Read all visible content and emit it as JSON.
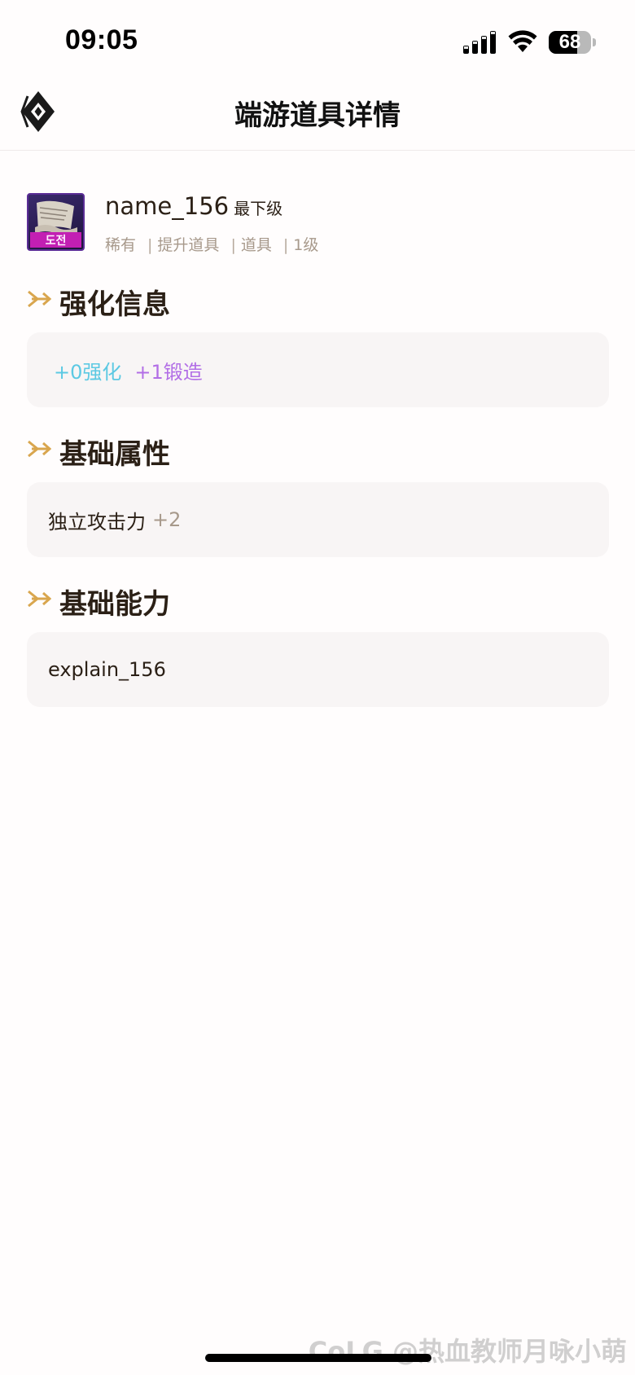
{
  "status_bar": {
    "time": "09:05",
    "battery": "68",
    "battery_level": 0.68
  },
  "nav": {
    "title": "端游道具详情",
    "back_icon": "diamond-back-icon"
  },
  "item": {
    "name": "name_156",
    "grade": "最下级",
    "tags": [
      "稀有",
      "提升道具",
      "道具",
      "1级"
    ],
    "icon_badge_text": "도전",
    "icon": "scroll-icon"
  },
  "sections": {
    "enhance": {
      "title": "强化信息",
      "enhance_label": "+0强化",
      "forge_label": "+1锻造"
    },
    "base_attributes": {
      "title": "基础属性",
      "attr_name": "独立攻击力",
      "attr_value": "+2"
    },
    "base_ability": {
      "title": "基础能力",
      "text": "explain_156"
    }
  },
  "watermark": "CoLG @热血教师月咏小萌",
  "colors": {
    "accent_gold": "#d9a64e",
    "enhance": "#5cc9e3",
    "forge": "#b26ee6",
    "muted": "#a7998b"
  }
}
